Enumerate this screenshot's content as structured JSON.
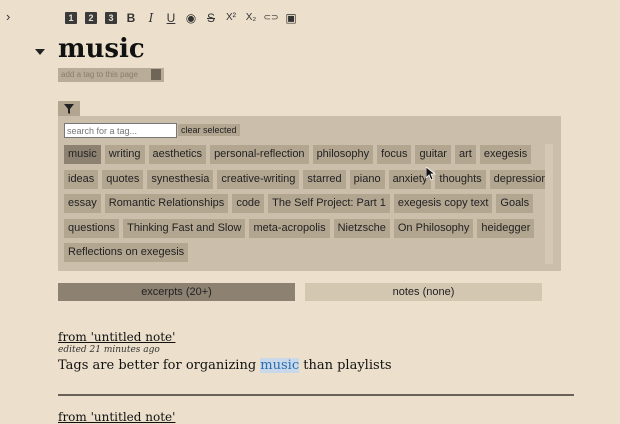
{
  "toolbar": {
    "items": [
      {
        "name": "heading-1-icon",
        "glyph": "1"
      },
      {
        "name": "heading-2-icon",
        "glyph": "2"
      },
      {
        "name": "heading-3-icon",
        "glyph": "3"
      },
      {
        "name": "bold-icon",
        "glyph": "B"
      },
      {
        "name": "italic-icon",
        "glyph": "I"
      },
      {
        "name": "underline-icon",
        "glyph": "U"
      },
      {
        "name": "hide-icon",
        "glyph": "◉"
      },
      {
        "name": "strikethrough-icon",
        "glyph": "S"
      },
      {
        "name": "superscript-icon",
        "glyph": "X²"
      },
      {
        "name": "subscript-icon",
        "glyph": "X₂"
      },
      {
        "name": "link-icon",
        "glyph": "⊂⊃"
      },
      {
        "name": "image-icon",
        "glyph": "▣"
      }
    ]
  },
  "page": {
    "title": "music"
  },
  "tag_input": {
    "placeholder": "add a tag to this page"
  },
  "filter": {
    "search_placeholder": "search for a tag...",
    "clear_label": "clear selected",
    "tag_rows": [
      [
        "music",
        "writing",
        "aesthetics",
        "personal-reflection",
        "philosophy",
        "focus",
        "guitar",
        "art",
        "exegesis"
      ],
      [
        "ideas",
        "quotes",
        "synesthesia",
        "creative-writing",
        "starred",
        "piano",
        "anxiety",
        "thoughts",
        "depression"
      ],
      [
        "essay",
        "Romantic Relationships",
        "code",
        "The Self Project: Part 1",
        "exegesis copy text",
        "Goals"
      ],
      [
        "questions",
        "Thinking Fast and Slow",
        "meta-acropolis",
        "Nietzsche",
        "On Philosophy",
        "heidegger"
      ],
      [
        "Reflections on exegesis"
      ]
    ],
    "selected_tag": "music"
  },
  "tabs": {
    "excerpts": "excerpts (20+)",
    "notes": "notes (none)"
  },
  "notes": [
    {
      "source": "from 'untitled note'",
      "edited": "edited 21 minutes ago",
      "text_before": "Tags are better for organizing ",
      "highlight": "music",
      "text_after": " than playlists"
    },
    {
      "source": "from 'untitled note'"
    }
  ],
  "colors": {
    "background": "#ece0cc",
    "panel": "#cbbfac",
    "tag": "#b3a691",
    "tag_selected": "#8d8272",
    "highlight": "#c9d9ea"
  }
}
